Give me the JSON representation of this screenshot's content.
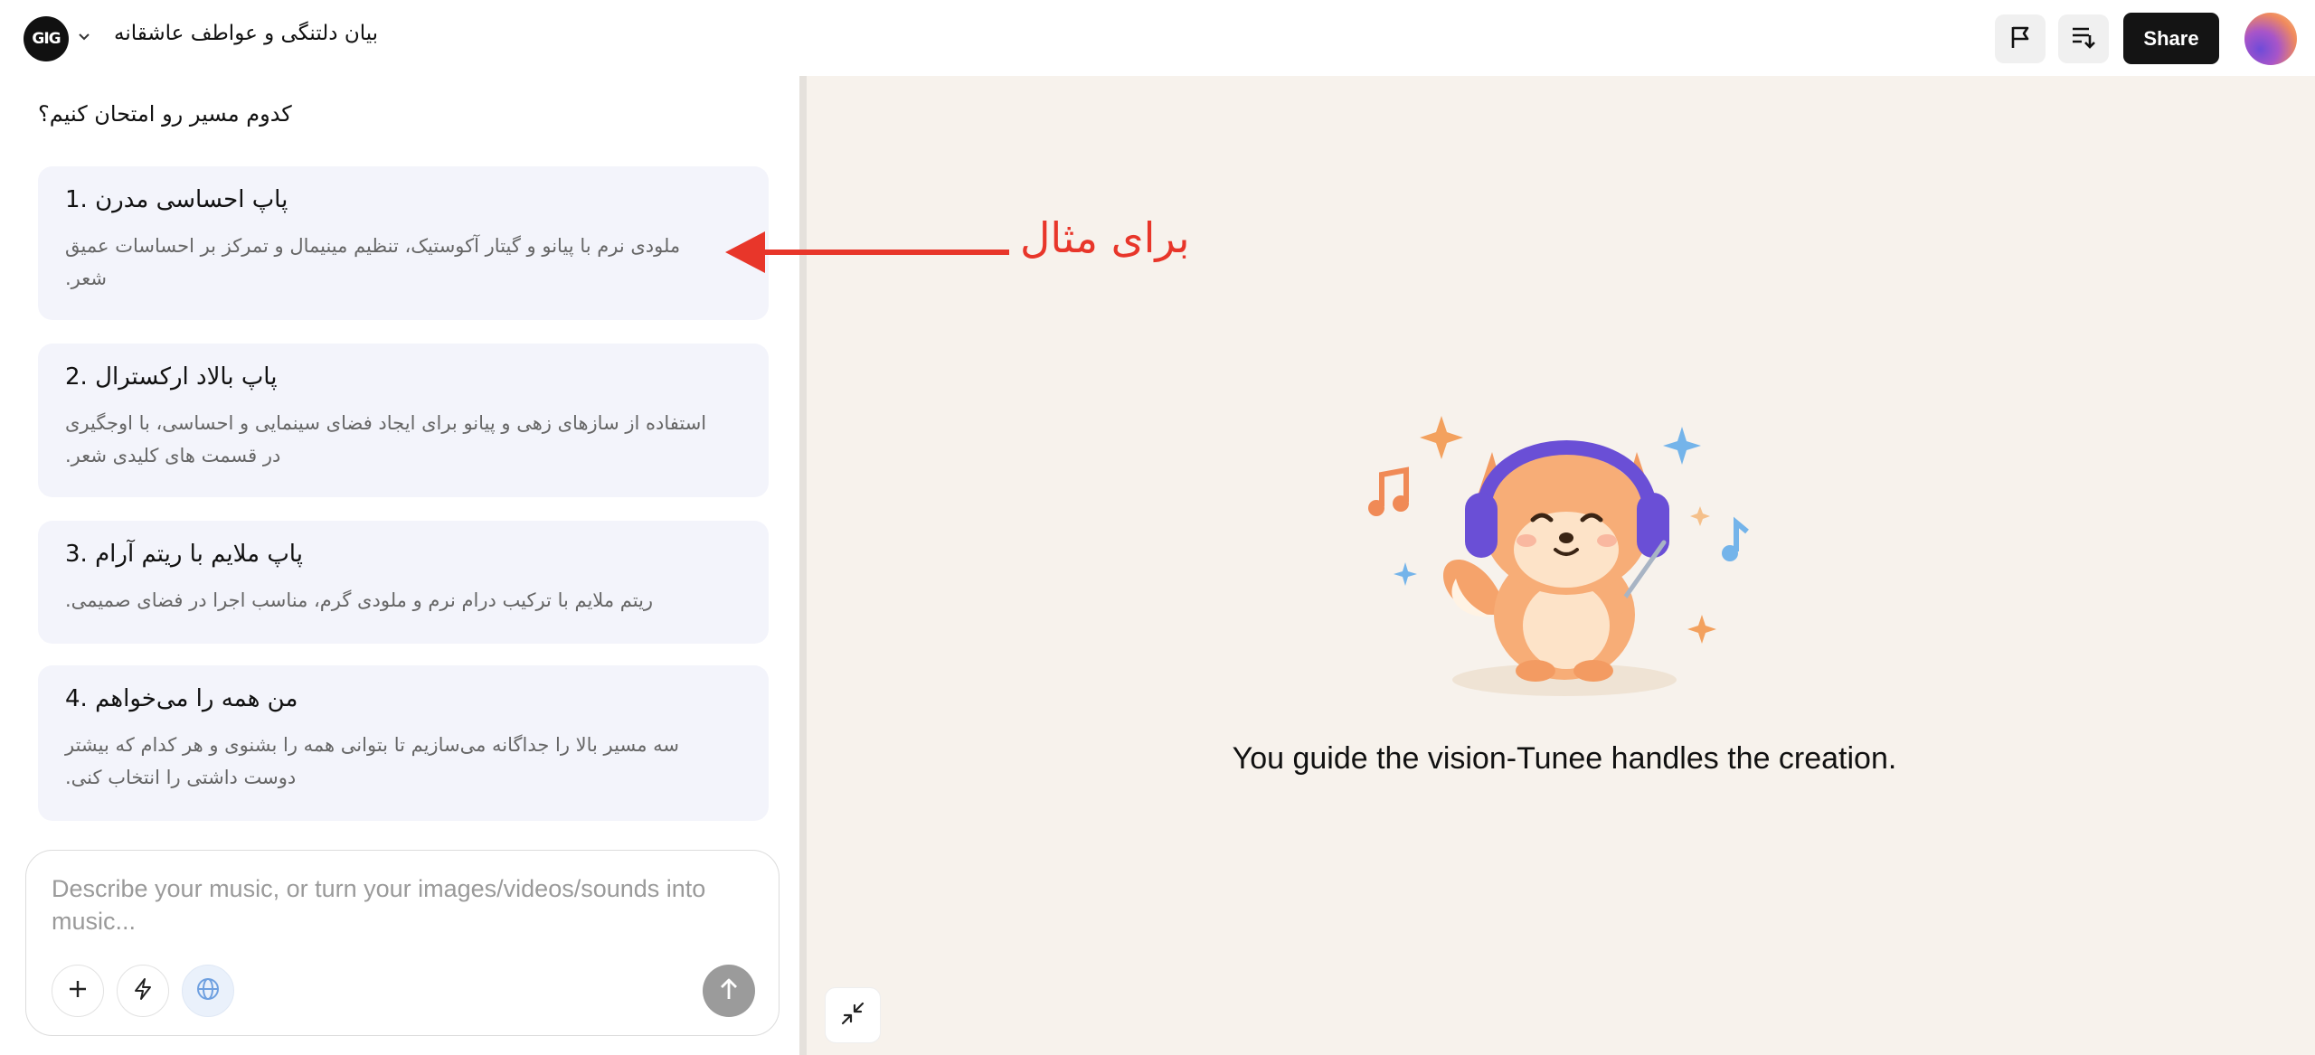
{
  "header": {
    "logo_text": "GIG",
    "project_title": "بیان دلتنگی و عواطف عاشقانه",
    "share_label": "Share",
    "icons": [
      "flag-icon",
      "playlist-icon",
      "chevron-down-icon"
    ]
  },
  "chat": {
    "question": "کدوم مسیر رو امتحان کنیم؟",
    "options": [
      {
        "title": "پاپ احساسی مدرن .1",
        "description": "ملودی نرم با پیانو و گیتار آکوستیک، تنظیم مینیمال و تمرکز بر احساسات عمیق شعر."
      },
      {
        "title": "پاپ بالاد ارکسترال .2",
        "description": "استفاده از سازهای زهی و پیانو برای ایجاد فضای سینمایی و احساسی، با اوجگیری در قسمت های کلیدی شعر."
      },
      {
        "title": "پاپ ملایم با ریتم آرام .3",
        "description": "ریتم ملایم با ترکیب درام نرم و ملودی گرم، مناسب اجرا در فضای صمیمی."
      },
      {
        "title": "من همه را می‌خواهم .4",
        "description": "سه مسیر بالا را جداگانه می‌سازیم تا بتوانی همه را بشنوی و هر کدام که بیشتر دوست داشتی را انتخاب کنی."
      }
    ]
  },
  "composer": {
    "placeholder": "Describe your music, or turn your images/videos/sounds into music...",
    "value": "",
    "icons": [
      "plus-icon",
      "lightning-icon",
      "globe-icon",
      "arrow-up-icon"
    ]
  },
  "annotation": {
    "text": "برای مثال",
    "color": "#e8362a"
  },
  "canvas": {
    "tagline": "You guide the vision-Tunee handles the creation.",
    "icons": [
      "fox-mascot-icon",
      "collapse-icon"
    ]
  },
  "colors": {
    "accent": "#e8362a",
    "share_bg": "#141414",
    "card_bg": "#f3f4fb",
    "canvas_bg": "#f7f2ec"
  }
}
